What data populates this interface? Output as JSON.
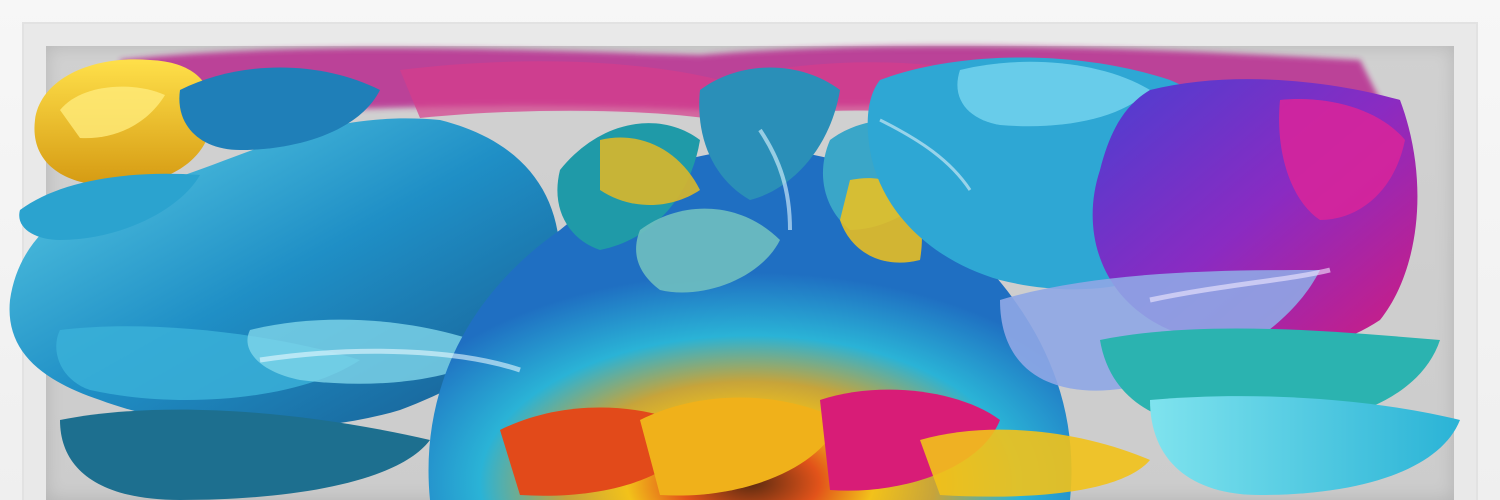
{
  "artwork": {
    "palette": {
      "cyan": "#2ab3d6",
      "teal": "#1f8fa0",
      "blue": "#1f6fc2",
      "yellow": "#f2c21a",
      "gold": "#d59a12",
      "magenta": "#d11c7e",
      "purple": "#7b2bbd",
      "orange": "#e2531a",
      "frame": "#efefef"
    }
  }
}
